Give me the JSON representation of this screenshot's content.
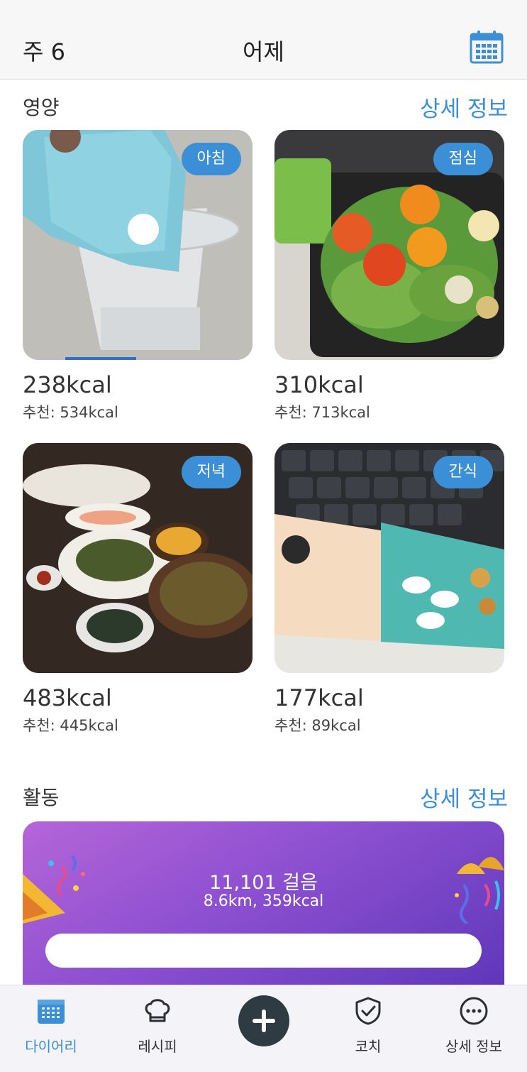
{
  "header": {
    "week_label": "주 6",
    "day_title": "어제"
  },
  "nutrition": {
    "title": "영양",
    "details_link": "상세 정보",
    "meals": [
      {
        "tag": "아침",
        "kcal": "238kcal",
        "recommended": "추천: 534kcal"
      },
      {
        "tag": "점심",
        "kcal": "310kcal",
        "recommended": "추천: 713kcal"
      },
      {
        "tag": "저녁",
        "kcal": "483kcal",
        "recommended": "추천: 445kcal"
      },
      {
        "tag": "간식",
        "kcal": "177kcal",
        "recommended": "추천: 89kcal"
      }
    ]
  },
  "activity": {
    "title": "활동",
    "details_link": "상세 정보",
    "steps": "11,101 걸음",
    "distance_kcal": "8.6km, 359kcal"
  },
  "tabbar": {
    "items": [
      {
        "label": "다이어리",
        "icon": "calendar-icon",
        "active": true
      },
      {
        "label": "레시피",
        "icon": "chef-hat-icon",
        "active": false
      },
      {
        "label": "",
        "icon": "plus-icon",
        "active": false
      },
      {
        "label": "코치",
        "icon": "shield-check-icon",
        "active": false
      },
      {
        "label": "상세 정보",
        "icon": "more-icon",
        "active": false
      }
    ]
  },
  "colors": {
    "accent": "#3b8fd6",
    "header_bg": "#f7f7f8",
    "activity_gradient_start": "#b565d8",
    "activity_gradient_end": "#5b35b8",
    "add_button": "#2f3b42"
  }
}
